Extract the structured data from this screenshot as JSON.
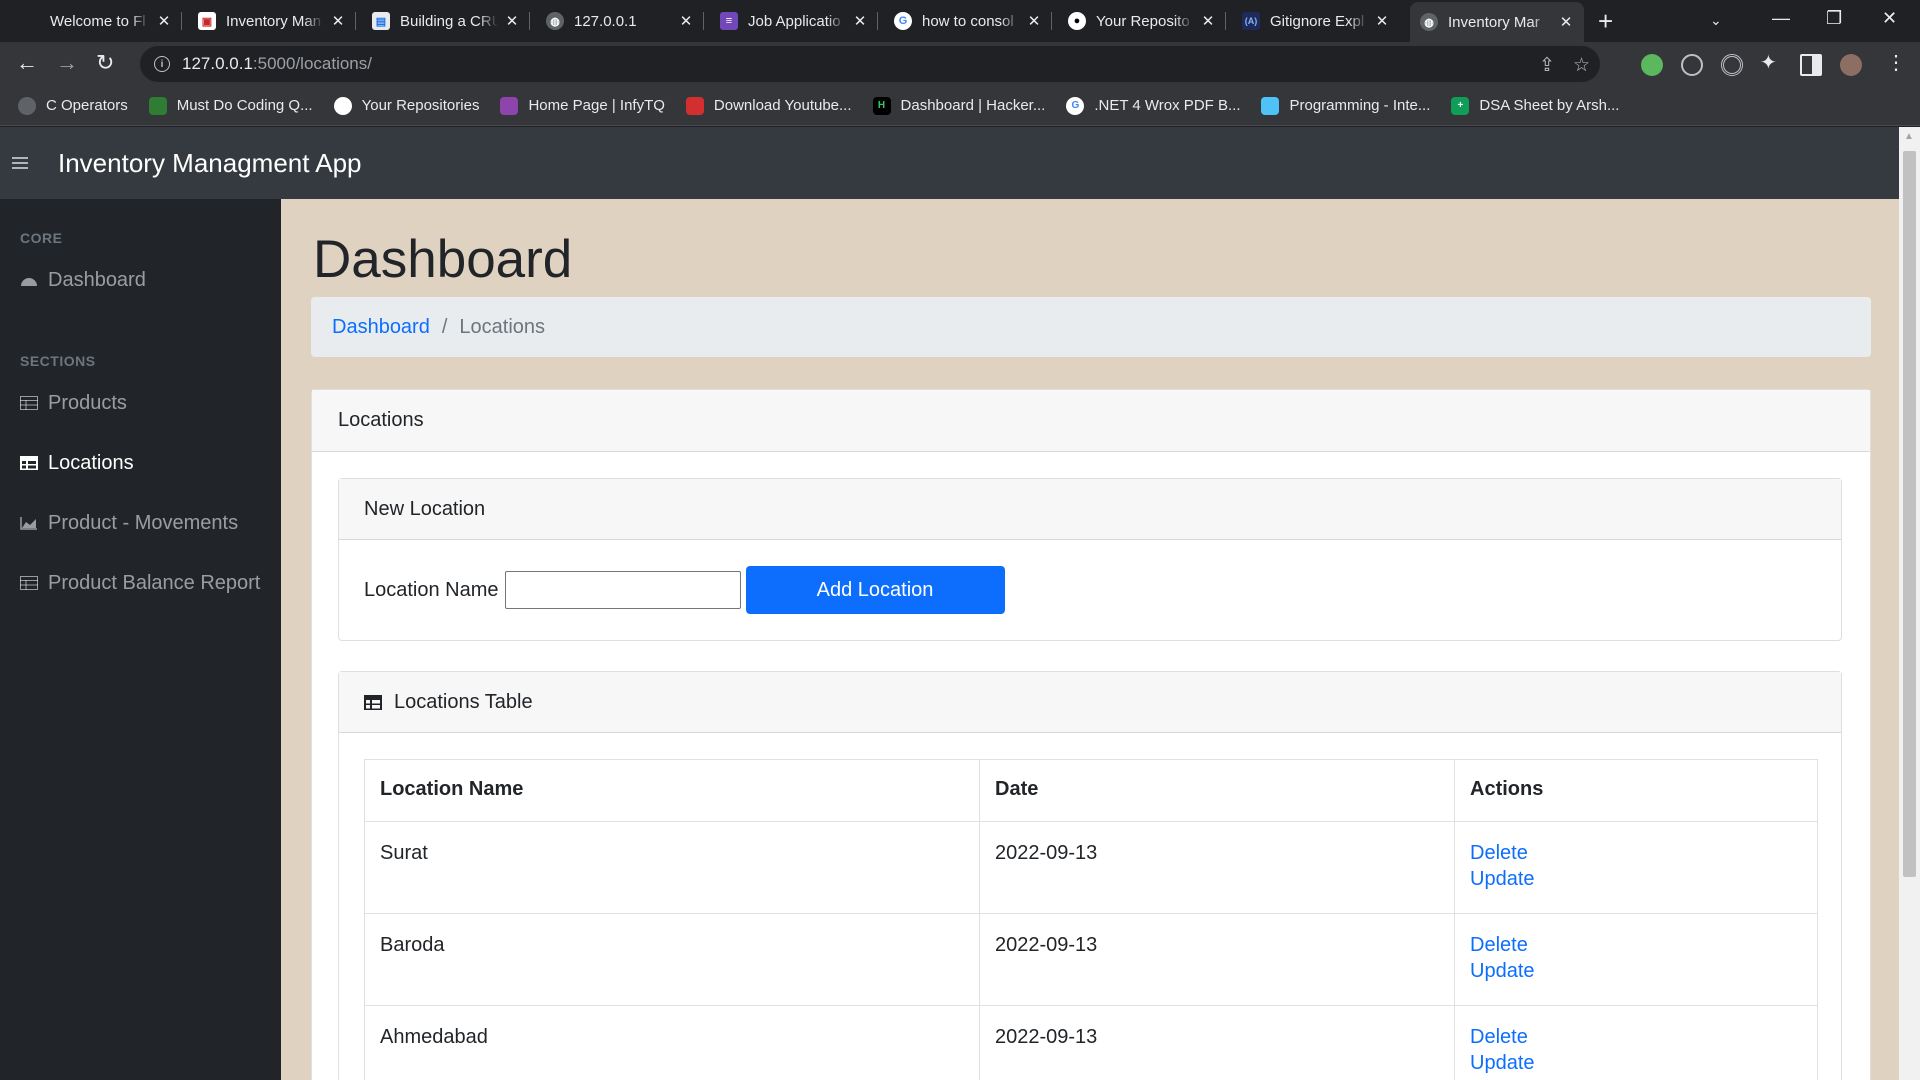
{
  "browser": {
    "tabs": [
      {
        "title": "Welcome to Fl",
        "color": "#202124"
      },
      {
        "title": "Inventory Man",
        "color": "#ffffff"
      },
      {
        "title": "Building a CRU",
        "color": "#1a73e8"
      },
      {
        "title": "127.0.0.1",
        "color": "#5f6368"
      },
      {
        "title": "Job Applicatio",
        "color": "#7248b9"
      },
      {
        "title": "how to consol",
        "color": "#ffffff"
      },
      {
        "title": "Your Reposito",
        "color": "#ffffff"
      },
      {
        "title": "Gitignore Expl",
        "color": "#1e2a5a"
      },
      {
        "title": "Inventory Mar",
        "color": "#5f6368"
      }
    ],
    "url_host": "127.0.0.1",
    "url_path": ":5000/locations/",
    "bookmarks": [
      {
        "label": "C Operators",
        "color": "#5f6368"
      },
      {
        "label": "Must Do Coding Q...",
        "color": "#2e7d32"
      },
      {
        "label": "Your Repositories",
        "color": "#ffffff"
      },
      {
        "label": "Home Page | InfyTQ",
        "color": "#8e44ad"
      },
      {
        "label": "Download Youtube...",
        "color": "#d32f2f"
      },
      {
        "label": "Dashboard | Hacker...",
        "color": "#000000"
      },
      {
        "label": ".NET 4 Wrox PDF B...",
        "color": "#ffffff"
      },
      {
        "label": "Programming - Inte...",
        "color": "#4fc3f7"
      },
      {
        "label": "DSA Sheet by Arsh...",
        "color": "#0f9d58"
      }
    ]
  },
  "app": {
    "brand": "Inventory Managment App",
    "sidebar": {
      "core_heading": "CORE",
      "sections_heading": "SECTIONS",
      "items": [
        {
          "label": "Dashboard",
          "icon": "dashboard-icon"
        },
        {
          "label": "Products",
          "icon": "table-icon"
        },
        {
          "label": "Locations",
          "icon": "table-icon"
        },
        {
          "label": "Product - Movements",
          "icon": "chart-area-icon"
        },
        {
          "label": "Product Balance Report",
          "icon": "table-icon"
        }
      ]
    },
    "page_title": "Dashboard",
    "breadcrumb": {
      "link": "Dashboard",
      "separator": "/",
      "current": "Locations"
    },
    "card_title": "Locations",
    "new_location": {
      "title": "New Location",
      "field_label": "Location Name",
      "field_value": "",
      "button": "Add Location"
    },
    "table": {
      "title": "Locations Table",
      "headers": [
        "Location Name",
        "Date",
        "Actions"
      ],
      "rows": [
        {
          "name": "Surat",
          "date": "2022-09-13",
          "delete": "Delete",
          "update": "Update"
        },
        {
          "name": "Baroda",
          "date": "2022-09-13",
          "delete": "Delete",
          "update": "Update"
        },
        {
          "name": "Ahmedabad",
          "date": "2022-09-13",
          "delete": "Delete",
          "update": "Update"
        }
      ]
    }
  }
}
